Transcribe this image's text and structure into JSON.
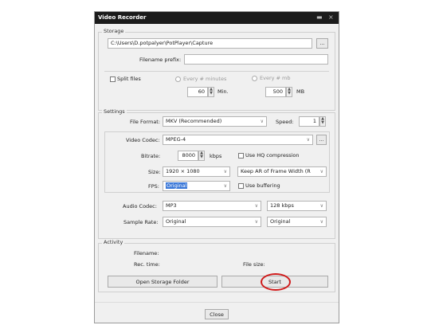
{
  "window": {
    "title": "Video Recorder",
    "min_glyph": "▬",
    "close_glyph": "×"
  },
  "storage": {
    "group_label": "Storage",
    "path": "C:\\Users\\D.potpalyer\\PotPlayer\\Capture",
    "browse_label": "...",
    "filename_prefix_label": "Filename prefix:",
    "filename_prefix_value": "",
    "split_files_label": "Split files",
    "every_minutes_label": "Every # minutes",
    "every_mb_label": "Every # mb",
    "minutes_value": "60",
    "minutes_unit": "Min.",
    "mb_value": "500",
    "mb_unit": "MB"
  },
  "settings": {
    "group_label": "Settings",
    "file_format_label": "File Format:",
    "file_format_value": "MKV (Recommended)",
    "speed_label": "Speed:",
    "speed_value": "1",
    "video_codec_label": "Video Codec:",
    "video_codec_value": "MPEG-4",
    "video_codec_more": "...",
    "bitrate_label": "Bitrate:",
    "bitrate_value": "8000",
    "bitrate_unit": "kbps",
    "hq_label": "Use HQ compression",
    "size_label": "Size:",
    "size_value": "1920 × 1080",
    "aspect_value": "Keep AR of Frame Width (R",
    "fps_label": "FPS:",
    "fps_value": "Original",
    "buffering_label": "Use buffering",
    "audio_codec_label": "Audio Codec:",
    "audio_codec_value": "MP3",
    "audio_bitrate_value": "128 kbps",
    "sample_rate_label": "Sample Rate:",
    "sample_rate_value": "Original",
    "channels_value": "Original"
  },
  "activity": {
    "group_label": "Activity",
    "filename_label": "Filename:",
    "rec_time_label": "Rec. time:",
    "file_size_label": "File size:",
    "open_folder_label": "Open Storage Folder",
    "start_label": "Start"
  },
  "footer": {
    "close_label": "Close"
  },
  "highlight": {
    "color": "#d01b1b"
  }
}
